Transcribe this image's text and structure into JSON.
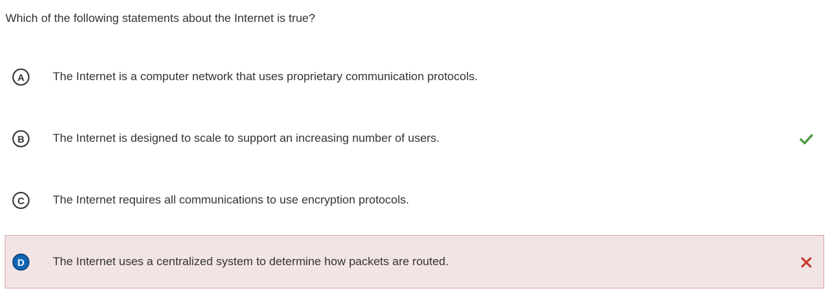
{
  "question": {
    "text": "Which of the following statements about the Internet is true?"
  },
  "options": [
    {
      "letter": "A",
      "text": "The Internet is a computer network that uses proprietary communication protocols.",
      "status": "none"
    },
    {
      "letter": "B",
      "text": "The Internet is designed to scale to support an increasing number of users.",
      "status": "correct",
      "icon": "check-icon"
    },
    {
      "letter": "C",
      "text": "The Internet requires all communications to use encryption protocols.",
      "status": "none"
    },
    {
      "letter": "D",
      "text": "The Internet uses a centralized system to determine how packets are routed.",
      "status": "incorrect-selected",
      "icon": "x-icon"
    }
  ],
  "colors": {
    "correct": "#4a9b3c",
    "incorrect": "#c9352c",
    "selected_letter": "#1266b3",
    "incorrect_background": "#f2e4e5",
    "incorrect_border": "#d9a4a9"
  }
}
